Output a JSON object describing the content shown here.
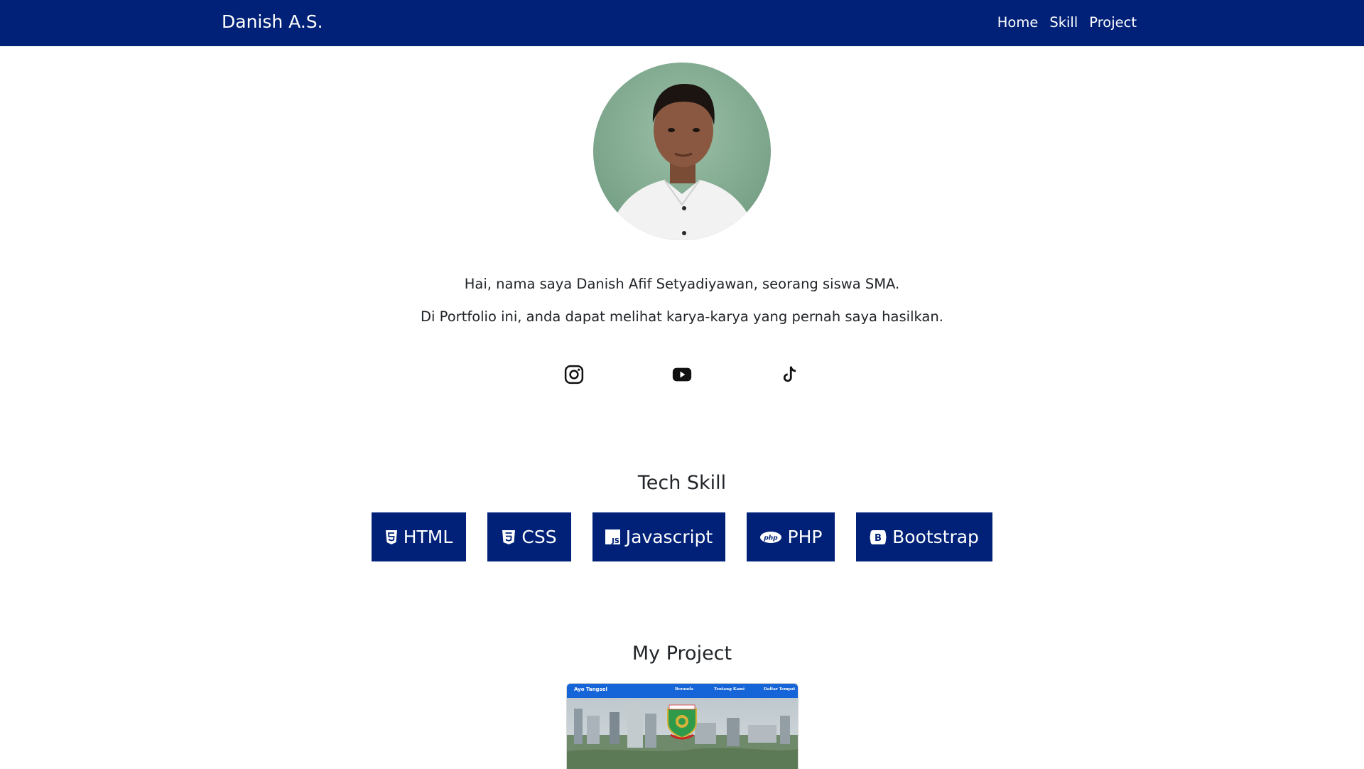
{
  "navbar": {
    "brand": "Danish A.S.",
    "links": [
      "Home",
      "Skill",
      "Project"
    ]
  },
  "profile": {
    "photo_alt": "profile-photo"
  },
  "intro": {
    "line1": "Hai, nama saya Danish Afif Setyadiyawan, seorang siswa SMA.",
    "line2": "Di Portfolio ini, anda dapat melihat karya-karya yang pernah saya hasilkan."
  },
  "social": [
    {
      "icon": "instagram-icon"
    },
    {
      "icon": "youtube-icon"
    },
    {
      "icon": "tiktok-icon"
    }
  ],
  "skills": {
    "title": "Tech Skill",
    "items": [
      {
        "label": "HTML",
        "icon": "html5-icon"
      },
      {
        "label": "CSS",
        "icon": "css3-icon"
      },
      {
        "label": "Javascript",
        "icon": "javascript-icon"
      },
      {
        "label": "PHP",
        "icon": "php-icon"
      },
      {
        "label": "Bootstrap",
        "icon": "bootstrap-icon"
      }
    ]
  },
  "projects": {
    "title": "My Project",
    "items": [
      {
        "brand": "Ayo Tangsel",
        "links": [
          "Beranda",
          "Tentang Kami",
          "Daftar Tempat"
        ]
      }
    ]
  },
  "colors": {
    "navbar_bg": "#002177",
    "button_bg": "#002177",
    "thumb_nav": "#1565d8"
  }
}
